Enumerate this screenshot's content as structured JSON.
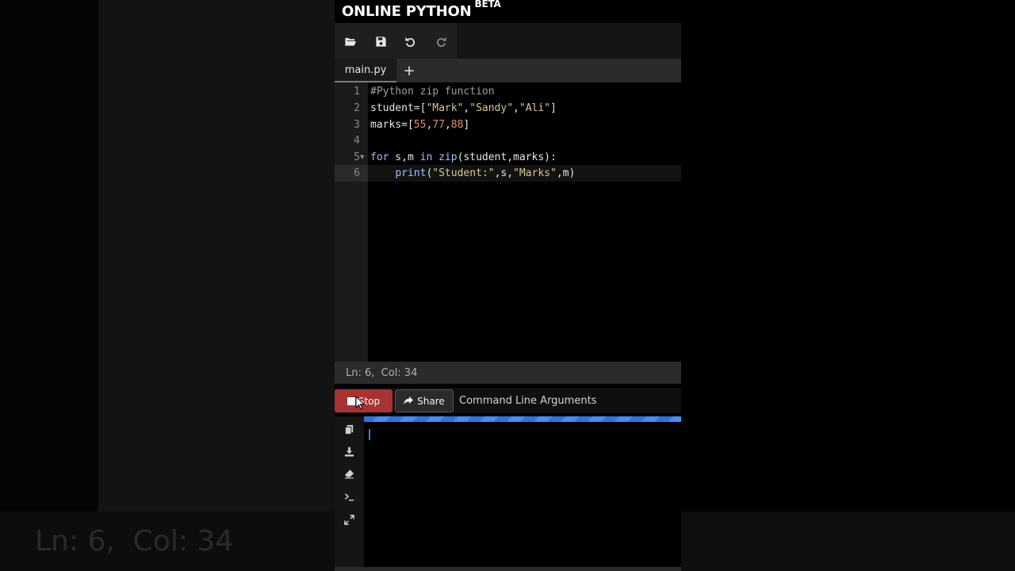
{
  "header": {
    "title": "ONLINE PYTHON",
    "badge": "BETA"
  },
  "toolbar": {
    "icons": [
      "folder-open-icon",
      "save-icon",
      "undo-icon",
      "redo-icon"
    ]
  },
  "tabs": {
    "active": "main.py",
    "add_label": "+"
  },
  "editor": {
    "line_numbers": [
      "1",
      "2",
      "3",
      "4",
      "5",
      "6"
    ],
    "lines": [
      "#Python zip function",
      "student=[\"Mark\",\"Sandy\",\"Ali\"]",
      "marks=[55,77,88]",
      "",
      "for s,m in zip(student,marks):",
      "    print(\"Student:\",s,\"Marks\",m)"
    ]
  },
  "status": {
    "text": "Ln: 6,  Col: 34"
  },
  "actions": {
    "stop_label": "Stop",
    "share_label": "Share",
    "cmd_args_label": "Command Line Arguments"
  },
  "console": {
    "side_icons": [
      "copy-icon",
      "download-icon",
      "eraser-icon",
      "terminal-icon",
      "expand-icon"
    ]
  },
  "background": {
    "echo_status": "Ln: 6,  Col: 34"
  },
  "colors": {
    "accent": "#3a7bf0",
    "stop": "#a83333"
  }
}
